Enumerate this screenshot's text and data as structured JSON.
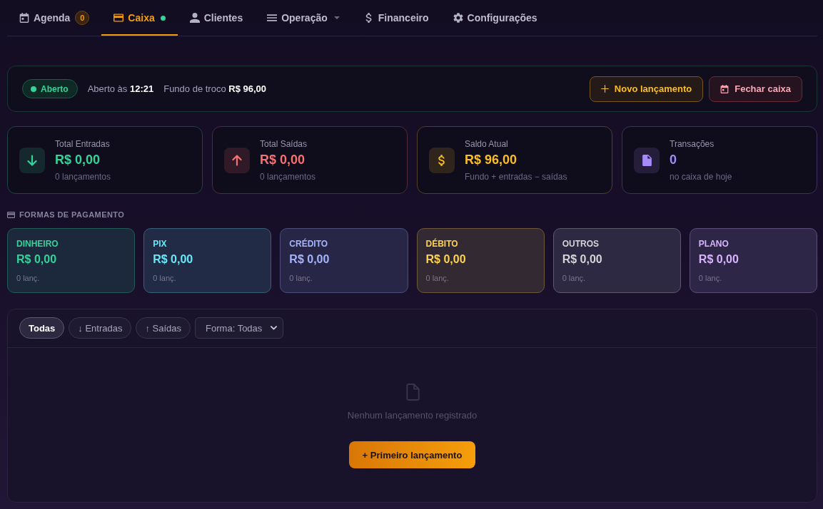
{
  "nav": {
    "tabs": [
      {
        "label": "Agenda",
        "badge": "0",
        "dot": false,
        "menu": false,
        "selected": false
      },
      {
        "label": "Caixa",
        "dot": true,
        "menu": false,
        "selected": true
      },
      {
        "label": "Clientes",
        "dot": false,
        "menu": false,
        "selected": false
      },
      {
        "label": "Operação",
        "dot": false,
        "menu": true,
        "selected": false
      },
      {
        "label": "Financeiro",
        "dot": false,
        "menu": false,
        "selected": false
      },
      {
        "label": "Configurações",
        "dot": false,
        "menu": false,
        "selected": false
      }
    ]
  },
  "register": {
    "status": {
      "label": "Aberto",
      "open": true
    },
    "opened_at": "Aberto às **12:21**",
    "change_fund": "Fundo de troco **R$ 96,00**",
    "actions": [
      {
        "label": "Novo lançamento",
        "kind": "primary"
      },
      {
        "label": "Fechar caixa",
        "kind": "danger"
      }
    ]
  },
  "stats": [
    {
      "label": "Total Entradas",
      "value": "R$ 0,00",
      "note": "0 lançamentos",
      "color": "#34d399"
    },
    {
      "label": "Total Saídas",
      "value": "R$ 0,00",
      "note": "0 lançamentos",
      "color": "#f87171"
    },
    {
      "label": "Saldo Atual",
      "value": "R$ 96,00",
      "note": "Fundo + entradas − saídas",
      "color": "#fbbf24"
    },
    {
      "label": "Transações",
      "value": "0",
      "note": "no caixa de hoje",
      "color": "#a78bfa"
    }
  ],
  "payment_methods": {
    "title": "FORMAS DE PAGAMENTO",
    "items": [
      {
        "label": "DINHEIRO",
        "value": "R$ 0,00",
        "note": "0 lanç.",
        "color": "#34d399"
      },
      {
        "label": "PIX",
        "value": "R$ 0,00",
        "note": "0 lanç.",
        "color": "#67e8f9"
      },
      {
        "label": "CRÉDITO",
        "value": "R$ 0,00",
        "note": "0 lanç.",
        "color": "#a5b4fc"
      },
      {
        "label": "DÉBITO",
        "value": "R$ 0,00",
        "note": "0 lanç.",
        "color": "#fcd34d"
      },
      {
        "label": "OUTROS",
        "value": "R$ 0,00",
        "note": "0 lanç.",
        "color": "#d4d4d8"
      },
      {
        "label": "PLANO",
        "value": "R$ 0,00",
        "note": "0 lanç.",
        "color": "#d8b4fe"
      }
    ]
  },
  "transactions": {
    "filters": [
      {
        "label": "Todas",
        "selected": true
      },
      {
        "label": "↓ Entradas",
        "selected": false
      },
      {
        "label": "↑ Saídas",
        "selected": false
      }
    ],
    "method_filter": {
      "value": "Forma: Todas"
    },
    "empty": {
      "message": "Nenhum lançamento registrado",
      "action": "+ Primeiro lançamento"
    }
  }
}
